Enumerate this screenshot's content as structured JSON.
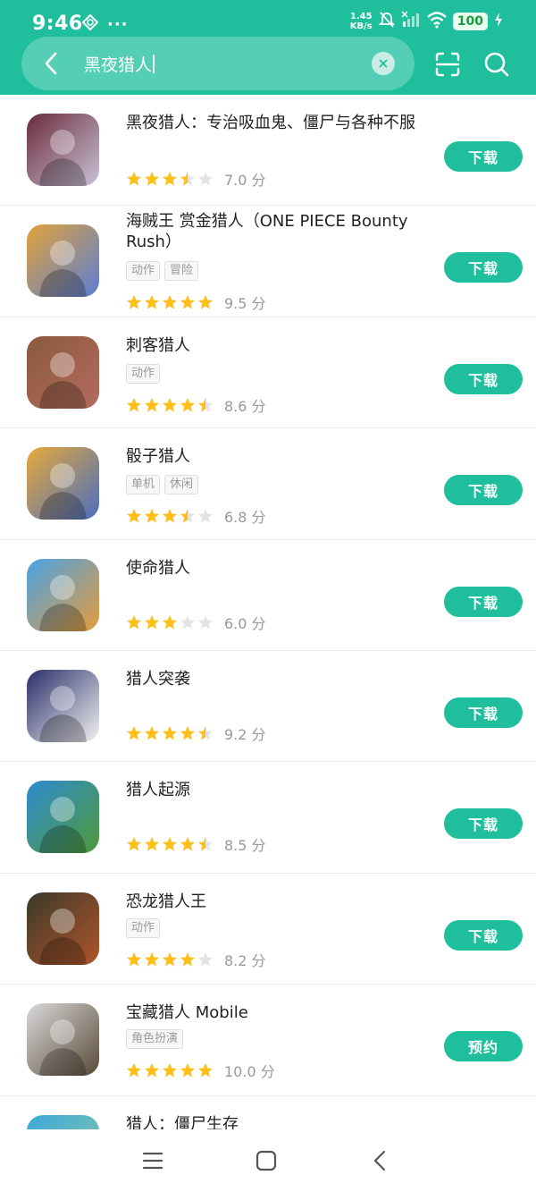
{
  "status_bar": {
    "time": "9:46",
    "net_speed_value": "1.45",
    "net_speed_unit": "KB/s",
    "battery": "100",
    "icons": [
      "vpn-icon",
      "more-dots-icon",
      "mute-icon",
      "signal-icon",
      "wifi-icon",
      "charging-icon"
    ]
  },
  "search": {
    "query": "黑夜猎人"
  },
  "colors": {
    "accent": "#1fbf9e",
    "star": "#ffbf1a",
    "star_empty": "#e3e3e3"
  },
  "apps": [
    {
      "name": "黑夜猎人：专治吸血鬼、僵尸与各种不服",
      "tags": [],
      "stars": 3.5,
      "score": "7.0 分",
      "action": "下载"
    },
    {
      "name": "海贼王 赏金猎人（ONE PIECE Bounty Rush）",
      "tags": [
        "动作",
        "冒险"
      ],
      "stars": 5,
      "score": "9.5 分",
      "action": "下载"
    },
    {
      "name": "刺客猎人",
      "tags": [
        "动作"
      ],
      "stars": 4.5,
      "score": "8.6 分",
      "action": "下载"
    },
    {
      "name": "骰子猎人",
      "tags": [
        "单机",
        "休闲"
      ],
      "stars": 3.5,
      "score": "6.8 分",
      "action": "下载"
    },
    {
      "name": "使命猎人",
      "tags": [],
      "stars": 3,
      "score": "6.0 分",
      "action": "下载"
    },
    {
      "name": "猎人突袭",
      "tags": [],
      "stars": 4.5,
      "score": "9.2 分",
      "action": "下载"
    },
    {
      "name": "猎人起源",
      "tags": [],
      "stars": 4.5,
      "score": "8.5 分",
      "action": "下载"
    },
    {
      "name": "恐龙猎人王",
      "tags": [
        "动作"
      ],
      "stars": 4,
      "score": "8.2 分",
      "action": "下载"
    },
    {
      "name": "宝藏猎人 Mobile",
      "tags": [
        "角色扮演"
      ],
      "stars": 5,
      "score": "10.0 分",
      "action": "预约"
    },
    {
      "name": "猎人：僵尸生存",
      "tags": [],
      "stars": 0,
      "score": "",
      "action": ""
    }
  ],
  "icon_themes": [
    [
      "#6a2b3a",
      "#c9c2d8"
    ],
    [
      "#e2a23a",
      "#5a7ed6"
    ],
    [
      "#8a5a3c",
      "#b46b5e"
    ],
    [
      "#e7a83a",
      "#4a6fbf"
    ],
    [
      "#4aa3e8",
      "#e59b3a"
    ],
    [
      "#2a2f6a",
      "#f1f1f1"
    ],
    [
      "#2e8bd0",
      "#4f9a3a"
    ],
    [
      "#3a3a2a",
      "#b0552a"
    ],
    [
      "#d9d9d9",
      "#5a4a3a"
    ],
    [
      "#3aa8d8",
      "#8fc9a8"
    ]
  ],
  "navbar": [
    "menu-icon",
    "home-icon",
    "back-icon"
  ]
}
